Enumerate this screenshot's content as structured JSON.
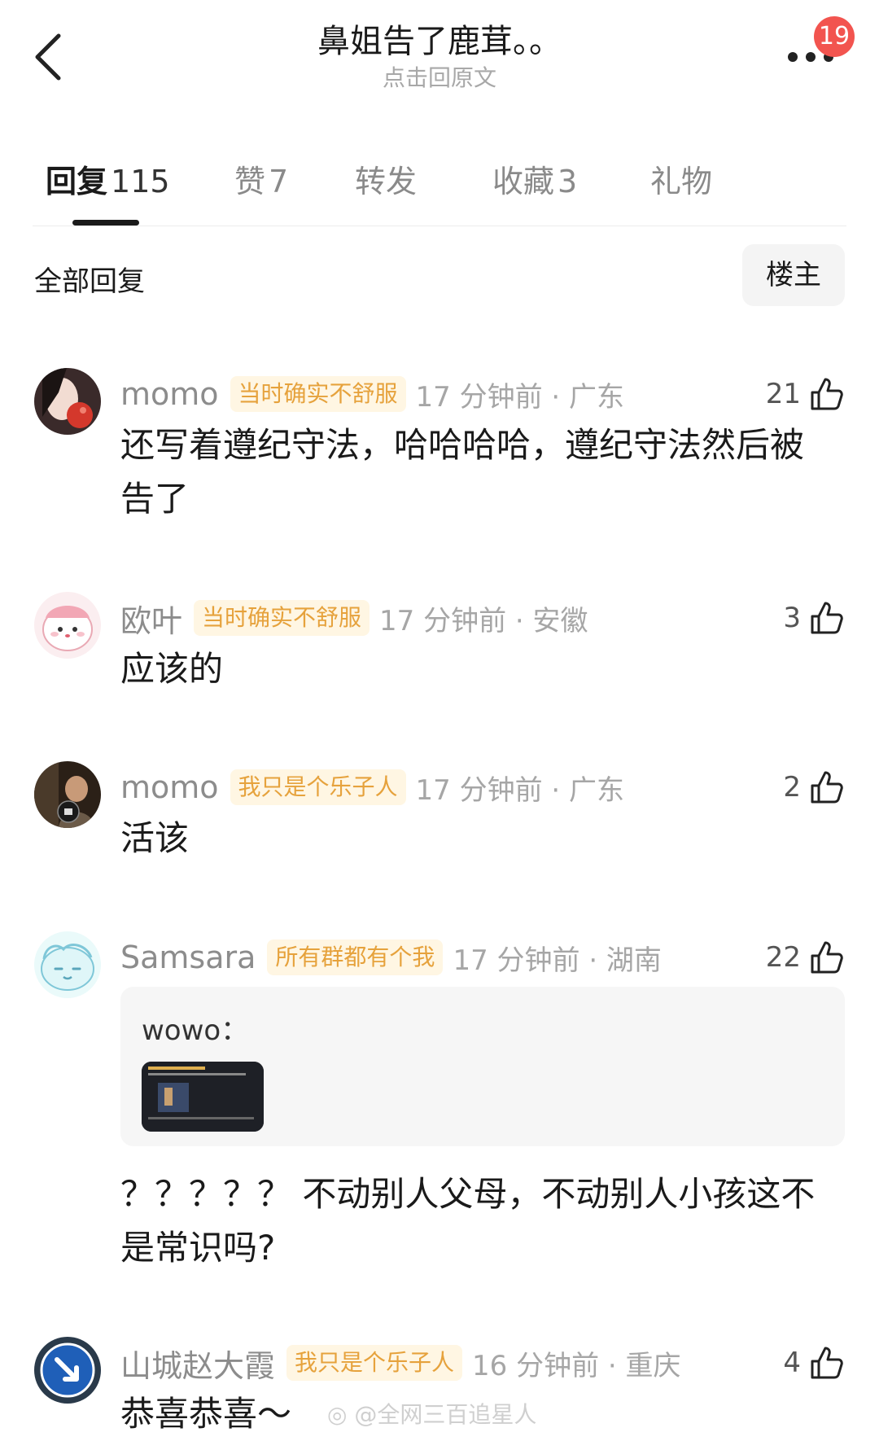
{
  "header": {
    "title": "鼻姐告了鹿茸。。",
    "subtitle": "点击回原文",
    "notification_count": "19"
  },
  "tabs": [
    {
      "label": "回复",
      "count": "115"
    },
    {
      "label": "赞",
      "count": "7"
    },
    {
      "label": "转发",
      "count": ""
    },
    {
      "label": "收藏",
      "count": "3"
    },
    {
      "label": "礼物",
      "count": ""
    }
  ],
  "filter": {
    "all_label": "全部回复",
    "op_label": "楼主"
  },
  "comments": [
    {
      "user": "momo",
      "tag": "当时确实不舒服",
      "time": "17 分钟前 · 广东",
      "likes": "21",
      "text": "还写着遵纪守法，哈哈哈哈，遵纪守法然后被告了"
    },
    {
      "user": "欧叶",
      "tag": "当时确实不舒服",
      "time": "17 分钟前 · 安徽",
      "likes": "3",
      "text": "应该的"
    },
    {
      "user": "momo",
      "tag": "我只是个乐子人",
      "time": "17 分钟前 · 广东",
      "likes": "2",
      "text": "活该"
    },
    {
      "user": "Samsara",
      "tag": "所有群都有个我",
      "time": "17 分钟前 · 湖南",
      "likes": "22",
      "quote_author": "wowo：",
      "text": "？？？？？ 不动别人父母，不动别人小孩这不是常识吗?"
    },
    {
      "user": "山城赵大霞",
      "tag": "我只是个乐子人",
      "time": "16 分钟前 · 重庆",
      "likes": "4",
      "text": "恭喜恭喜～"
    }
  ],
  "watermark": "@全网三百追星人",
  "colors": {
    "badge": "#f2544f",
    "tag_text": "#e6a23c",
    "tag_bg": "#fff6e3",
    "muted": "#a6a6a6"
  }
}
